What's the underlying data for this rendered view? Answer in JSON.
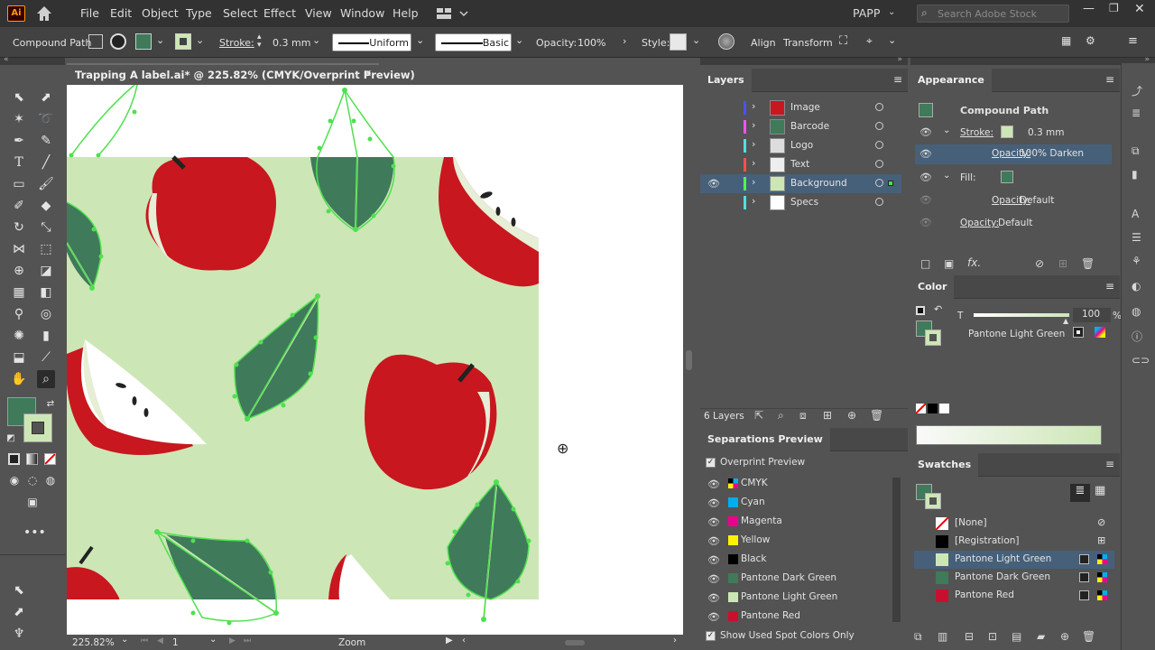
{
  "menu": {
    "app_logo": "Ai",
    "items": [
      "File",
      "Edit",
      "Object",
      "Type",
      "Select",
      "Effect",
      "View",
      "Window",
      "Help"
    ],
    "workspace": "PAPP",
    "search_placeholder": "Search Adobe Stock"
  },
  "control_bar": {
    "selection_type": "Compound Path",
    "stroke_label": "Stroke:",
    "stroke_value": "0.3 mm",
    "stroke_profile": "Uniform",
    "brush": "Basic",
    "opacity_label": "Opacity:",
    "opacity_value": "100%",
    "style_label": "Style:",
    "align_label": "Align",
    "transform_label": "Transform"
  },
  "document": {
    "tab_title": "Trapping A label.ai* @ 225.82% (CMYK/Overprint Preview)",
    "zoom": "225.82%",
    "artboard": "1",
    "status": "Zoom"
  },
  "layers": {
    "title": "Layers",
    "items": [
      {
        "name": "Image",
        "color": "#4f4fff",
        "visible": false,
        "active": false
      },
      {
        "name": "Barcode",
        "color": "#ff4fff",
        "visible": false,
        "active": false
      },
      {
        "name": "Logo",
        "color": "#4fe0e0",
        "visible": false,
        "active": false
      },
      {
        "name": "Text",
        "color": "#ff4f4f",
        "visible": false,
        "active": false
      },
      {
        "name": "Background",
        "color": "#4fff4f",
        "visible": true,
        "active": true
      },
      {
        "name": "Specs",
        "color": "#4fe0e0",
        "visible": false,
        "active": false
      }
    ],
    "count": "6 Layers"
  },
  "appearance": {
    "title": "Appearance",
    "object": "Compound Path",
    "stroke_label": "Stroke:",
    "stroke_value": "0.3 mm",
    "stroke_opacity_label": "Opacity:",
    "stroke_opacity_value": "100% Darken",
    "fill_label": "Fill:",
    "fill_opacity_label": "Opacity:",
    "fill_opacity_value": "Default",
    "opacity_label": "Opacity:",
    "opacity_value": "Default",
    "fx": "fx."
  },
  "color": {
    "title": "Color",
    "tint_label": "T",
    "tint_value": "100",
    "percent": "%",
    "swatch_name": "Pantone Light Green"
  },
  "separations": {
    "title": "Separations Preview",
    "overprint_label": "Overprint Preview",
    "items": [
      {
        "name": "CMYK",
        "color": "cmyk"
      },
      {
        "name": "Cyan",
        "color": "#00aeef"
      },
      {
        "name": "Magenta",
        "color": "#ec008c"
      },
      {
        "name": "Yellow",
        "color": "#fff200"
      },
      {
        "name": "Black",
        "color": "#000000"
      },
      {
        "name": "Pantone Dark Green",
        "color": "#3f7a5a"
      },
      {
        "name": "Pantone Light Green",
        "color": "#cde6b6"
      },
      {
        "name": "Pantone Red",
        "color": "#c8102e"
      }
    ],
    "spot_only_label": "Show Used Spot Colors Only"
  },
  "swatches": {
    "title": "Swatches",
    "items": [
      {
        "name": "[None]",
        "color": "none"
      },
      {
        "name": "[Registration]",
        "color": "#000000"
      },
      {
        "name": "Pantone Light Green",
        "color": "#cde6b6",
        "selected": true
      },
      {
        "name": "Pantone Dark Green",
        "color": "#3f7a5a"
      },
      {
        "name": "Pantone Red",
        "color": "#c8102e"
      }
    ]
  },
  "colors": {
    "dark_green": "#3f7a5a",
    "light_green": "#cde6b6",
    "red": "#c8102e",
    "selection": "#4fe04f"
  }
}
